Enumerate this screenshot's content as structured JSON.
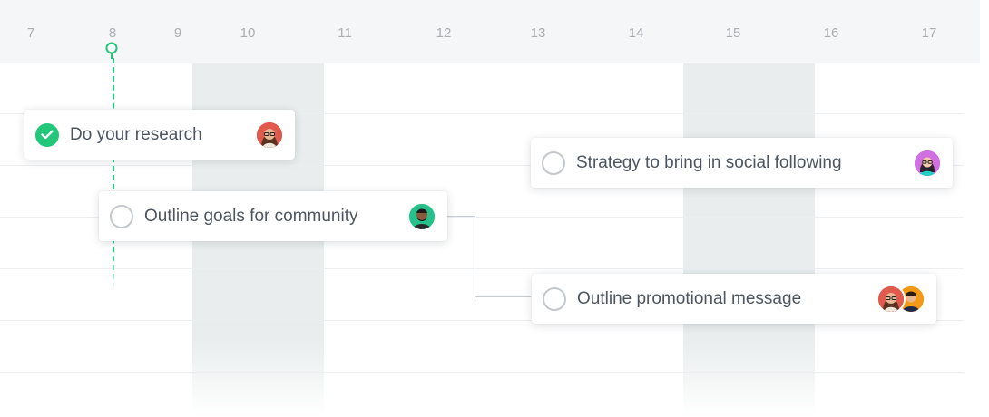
{
  "timeline": {
    "days": [
      "7",
      "8",
      "9",
      "10",
      "11",
      "12",
      "13",
      "14",
      "15",
      "16",
      "17"
    ]
  },
  "tasks": [
    {
      "label": "Do your research",
      "status": "done",
      "assignee_icon": "avatar-woman-glasses"
    },
    {
      "label": "Outline goals for community",
      "status": "todo",
      "assignee_icon": "avatar-man-beard"
    },
    {
      "label": "Strategy to bring in social following",
      "status": "todo",
      "assignee_icon": "avatar-woman-pink"
    },
    {
      "label": "Outline promotional message",
      "status": "todo",
      "assignee_icon": "avatar-group"
    }
  ],
  "colors": {
    "accent": "#22c77a",
    "header_bg": "#f5f6f7",
    "weekend_bg": "#e9eded",
    "text": "#4d5560",
    "day_text": "#a9aeb3"
  }
}
